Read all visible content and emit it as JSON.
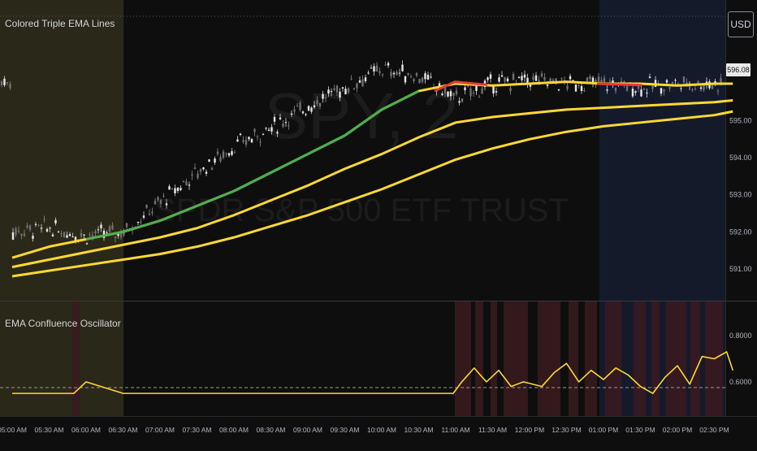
{
  "price_pane": {
    "title": "Colored Triple EMA Lines",
    "watermark_symbol": "SPY, 2",
    "watermark_name": "SPDR S&P 500 ETF TRUST",
    "currency": "USD",
    "last_price": "596.08",
    "y_ticks": [
      "595.00",
      "594.00",
      "593.00",
      "592.00",
      "591.00"
    ]
  },
  "osc_pane": {
    "title": "EMA Confluence Oscillator",
    "y_ticks": [
      "0.8000",
      "0.6000"
    ]
  },
  "colors": {
    "background": "#0e0e0e",
    "premarket": "#2a2818",
    "afternoon": "#141a2a",
    "ema_bull": "#4caf50",
    "ema_neutral": "#fdd835",
    "ema_bear": "#e53935",
    "osc_line": "#fdd835",
    "osc_band": "#3a1a1e"
  },
  "x_ticks": [
    "05:00 AM",
    "05:30 AM",
    "06:00 AM",
    "06:30 AM",
    "07:00 AM",
    "07:30 AM",
    "08:00 AM",
    "08:30 AM",
    "09:00 AM",
    "09:30 AM",
    "10:00 AM",
    "10:30 AM",
    "11:00 AM",
    "11:30 AM",
    "12:00 PM",
    "12:30 PM",
    "01:00 PM",
    "01:30 PM",
    "02:00 PM",
    "02:30 PM"
  ],
  "chart_data": [
    {
      "type": "line",
      "title": "Colored Triple EMA Lines",
      "x": [
        "05:00 AM",
        "05:30 AM",
        "06:00 AM",
        "06:30 AM",
        "07:00 AM",
        "07:30 AM",
        "08:00 AM",
        "08:30 AM",
        "09:00 AM",
        "09:30 AM",
        "10:00 AM",
        "10:30 AM",
        "11:00 AM",
        "11:30 AM",
        "12:00 PM",
        "12:30 PM",
        "01:00 PM",
        "01:30 PM",
        "02:00 PM",
        "02:30 PM",
        "02:45 PM"
      ],
      "series": [
        {
          "values": [
            592.0,
            592.1,
            591.9,
            592.0,
            592.8,
            593.6,
            594.3,
            594.8,
            595.4,
            595.9,
            596.4,
            596.2,
            595.6,
            596.0,
            596.1,
            596.0,
            596.0,
            595.9,
            596.0,
            596.0,
            596.05
          ]
        },
        {
          "values": [
            591.3,
            591.6,
            591.8,
            592.0,
            592.3,
            592.7,
            593.1,
            593.6,
            594.1,
            594.6,
            595.3,
            595.8,
            596.0,
            595.95,
            596.0,
            596.05,
            596.0,
            596.0,
            595.95,
            596.0,
            596.0
          ]
        },
        {
          "values": [
            591.05,
            591.25,
            591.45,
            591.65,
            591.85,
            592.1,
            592.45,
            592.85,
            593.25,
            593.7,
            594.1,
            594.55,
            594.95,
            595.1,
            595.2,
            595.3,
            595.35,
            595.4,
            595.45,
            595.5,
            595.55
          ]
        },
        {
          "values": [
            590.8,
            590.95,
            591.1,
            591.25,
            591.4,
            591.6,
            591.85,
            592.15,
            592.45,
            592.8,
            593.15,
            593.55,
            593.95,
            594.25,
            594.5,
            594.7,
            594.85,
            594.95,
            595.05,
            595.15,
            595.25
          ]
        }
      ],
      "ylim": [
        590.8,
        597.6
      ]
    },
    {
      "type": "line",
      "title": "EMA Confluence Oscillator",
      "x": [
        "05:00 AM",
        "05:30 AM",
        "05:50 AM",
        "06:00 AM",
        "06:30 AM",
        "07:00 AM",
        "08:00 AM",
        "09:00 AM",
        "10:00 AM",
        "10:30 AM",
        "10:58 AM",
        "11:05 AM",
        "11:15 AM",
        "11:25 AM",
        "11:35 AM",
        "11:45 AM",
        "11:55 AM",
        "12:10 PM",
        "12:20 PM",
        "12:30 PM",
        "12:40 PM",
        "12:50 PM",
        "01:00 PM",
        "01:10 PM",
        "01:20 PM",
        "01:30 PM",
        "01:40 PM",
        "01:50 PM",
        "02:00 PM",
        "02:10 PM",
        "02:20 PM",
        "02:30 PM",
        "02:40 PM",
        "02:45 PM"
      ],
      "values": [
        0.55,
        0.55,
        0.55,
        0.6,
        0.55,
        0.55,
        0.55,
        0.55,
        0.55,
        0.55,
        0.55,
        0.6,
        0.66,
        0.6,
        0.65,
        0.58,
        0.6,
        0.58,
        0.64,
        0.68,
        0.6,
        0.65,
        0.61,
        0.66,
        0.63,
        0.58,
        0.55,
        0.62,
        0.67,
        0.59,
        0.71,
        0.7,
        0.73,
        0.65
      ],
      "dashed_reference": 0.575,
      "ylim": [
        0.48,
        0.92
      ]
    }
  ]
}
